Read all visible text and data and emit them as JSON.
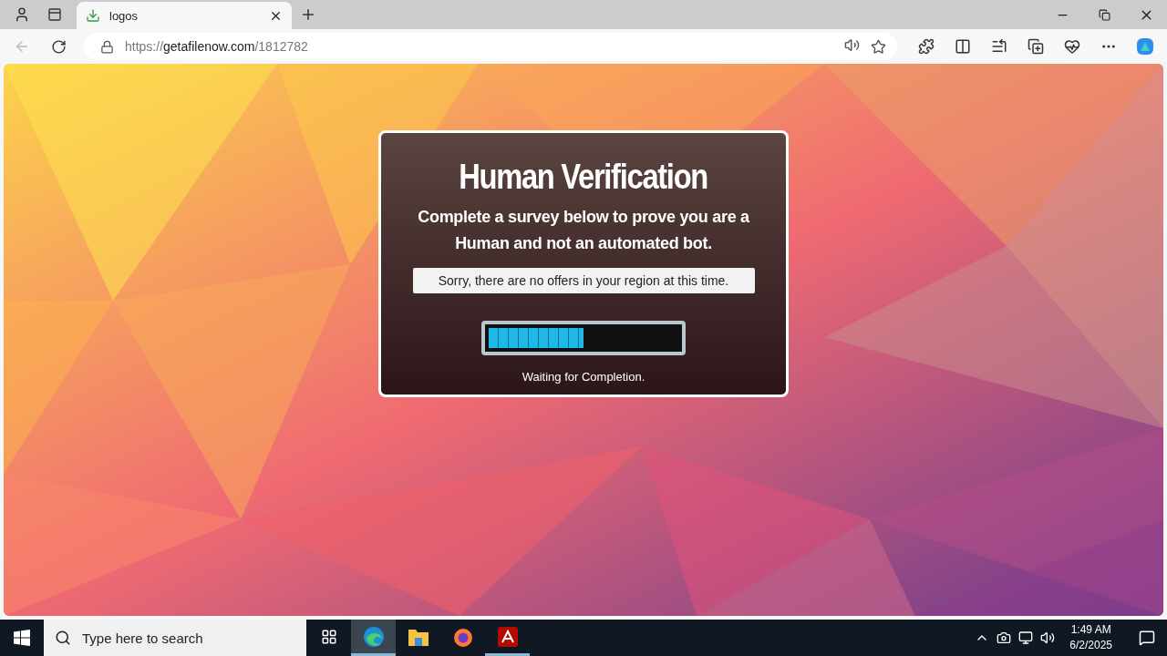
{
  "browser": {
    "tabs": [
      {
        "title": "logos",
        "selected": true
      }
    ],
    "address": {
      "scheme": "https://",
      "host": "getafilenow.com",
      "path": "/1812782"
    }
  },
  "dialog": {
    "title": "Human Verification",
    "message": "Complete a survey below to prove you are a Human and not an automated bot.",
    "notice": "Sorry, there are no offers in your region at this time.",
    "progress": {
      "level": 0.5
    },
    "status": "Waiting for Completion."
  },
  "taskbar": {
    "search": {
      "placeholder": "Type here to search"
    },
    "apps": [
      {
        "kind": "edge",
        "selected": true,
        "running": true
      },
      {
        "kind": "files",
        "selected": false,
        "running": false
      },
      {
        "kind": "firefox",
        "selected": false,
        "running": false
      },
      {
        "kind": "acrobat",
        "selected": false,
        "running": true
      }
    ],
    "clock": {
      "time": "1:49 AM",
      "date": "6/2/2025"
    }
  }
}
